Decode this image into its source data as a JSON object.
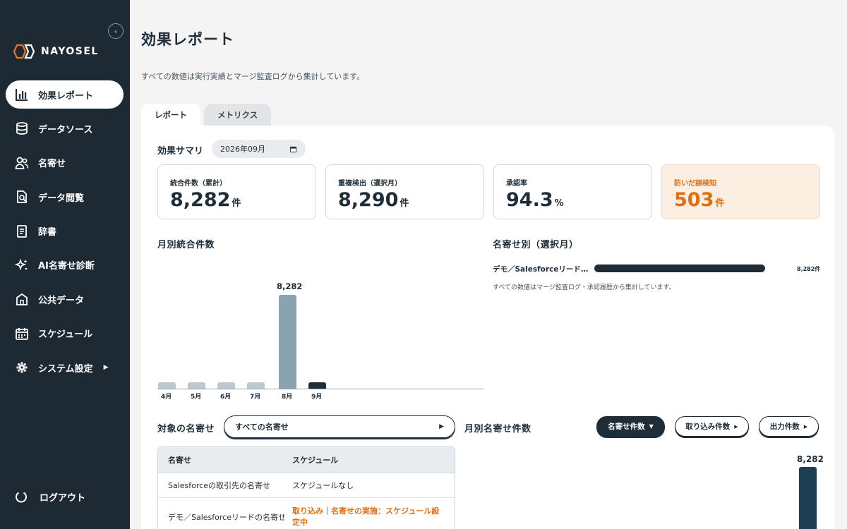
{
  "app": {
    "name": "NAYOSEL",
    "collapse_icon": "chevron-left-icon"
  },
  "sidebar": {
    "items": [
      {
        "label": "効果レポート",
        "icon": "bar-chart-icon",
        "active": true
      },
      {
        "label": "データソース",
        "icon": "database-icon"
      },
      {
        "label": "名寄せ",
        "icon": "users-icon"
      },
      {
        "label": "データ閲覧",
        "icon": "document-search-icon"
      },
      {
        "label": "辞書",
        "icon": "book-icon"
      },
      {
        "label": "AI名寄せ診断",
        "icon": "sparkle-icon"
      },
      {
        "label": "公共データ",
        "icon": "building-icon"
      },
      {
        "label": "スケジュール",
        "icon": "calendar-icon"
      },
      {
        "label": "システム設定",
        "icon": "gear-icon",
        "arrow": "▶"
      }
    ],
    "logout": {
      "label": "ログアウト",
      "icon": "power-icon"
    }
  },
  "header": {
    "title": "効果レポート",
    "description": "すべての数値は実行実績とマージ監査ログから集計しています。"
  },
  "tabs": [
    {
      "label": "レポート",
      "active": true
    },
    {
      "label": "メトリクス",
      "active": false
    }
  ],
  "summary": {
    "title": "効果サマリ",
    "month_value": "2026年09月",
    "kpis": [
      {
        "label": "統合件数（累計）",
        "value": "8,282",
        "unit": "件"
      },
      {
        "label": "重複検出（選択月）",
        "value": "8,290",
        "unit": "件"
      },
      {
        "label": "承認率",
        "value": "94.3",
        "unit": "%"
      },
      {
        "label": "防いだ誤検知",
        "value": "503",
        "unit": "件",
        "highlight": true
      }
    ]
  },
  "monthly_chart": {
    "title": "月別統合件数"
  },
  "chart_data": {
    "type": "bar",
    "categories": [
      "4月",
      "5月",
      "6月",
      "7月",
      "8月",
      "9月"
    ],
    "values": [
      0,
      0,
      0,
      0,
      8282,
      0
    ],
    "data_labels": [
      "",
      "",
      "",
      "",
      "8,282",
      ""
    ],
    "highlight_index": 5,
    "ymax": 8282,
    "colors": {
      "muted": "#bcc7ce",
      "main": "#89a4ae",
      "selected": "#1f2d38"
    }
  },
  "by_merge": {
    "title": "名寄せ別（選択月）",
    "items": [
      {
        "name": "デモ／Salesforceリード…",
        "value": "8,282件"
      }
    ],
    "note": "すべての数値はマージ監査ログ・承認履歴から集計しています。"
  },
  "target": {
    "title": "対象の名寄せ",
    "selected": "すべての名寄せ",
    "arrow": "▶"
  },
  "monthly_merge": {
    "title": "月別名寄せ件数",
    "buttons": [
      {
        "label": "名寄せ件数",
        "arrow": "▼",
        "active": true
      },
      {
        "label": "取り込み件数",
        "arrow": "▶"
      },
      {
        "label": "出力件数",
        "arrow": "▶"
      }
    ],
    "bar_value": "8,282"
  },
  "table": {
    "headers": [
      "名寄せ",
      "スケジュール"
    ],
    "rows": [
      {
        "name": "Salesforceの取引先の名寄せ",
        "schedule": "スケジュールなし",
        "highlight": false
      },
      {
        "name": "デモ／Salesforceリードの名寄せ",
        "schedule": "取り込み｜名寄せの実施：スケジュール設定中",
        "highlight": true
      }
    ]
  }
}
